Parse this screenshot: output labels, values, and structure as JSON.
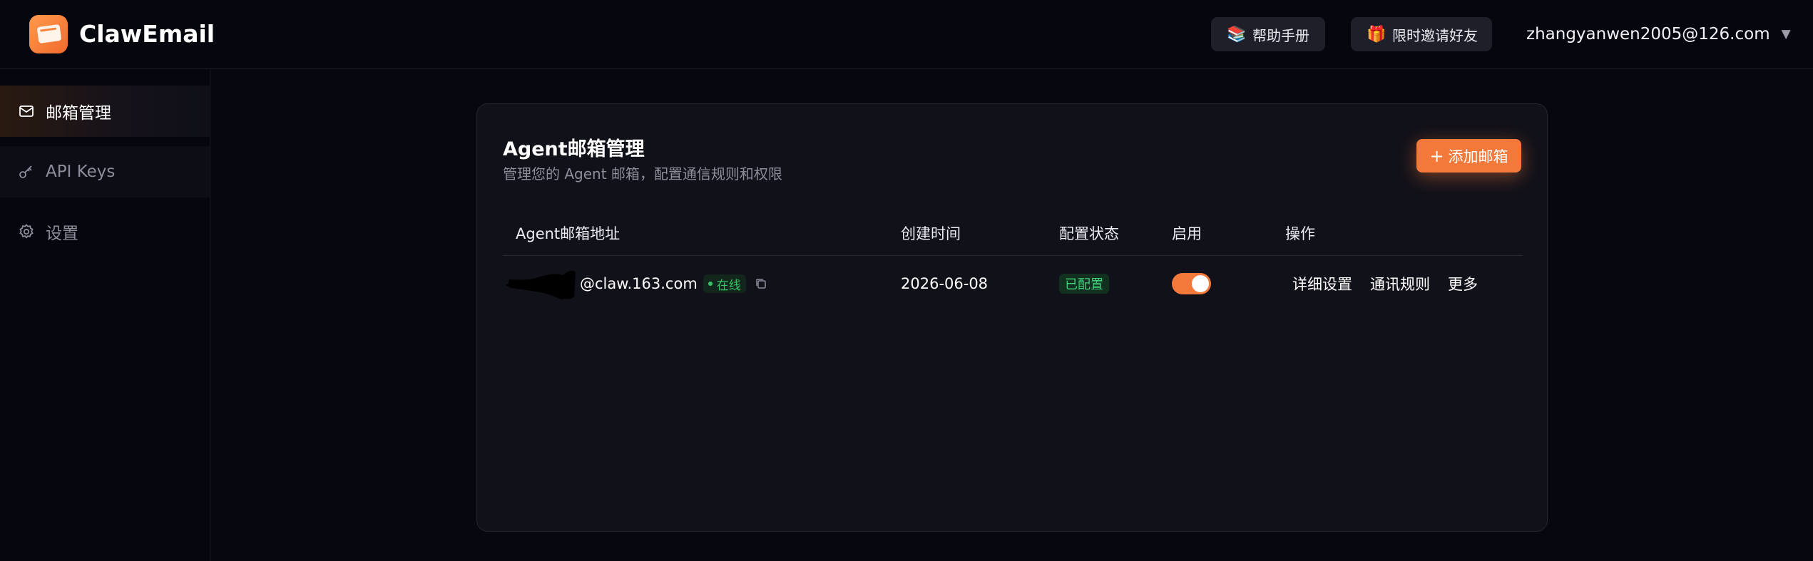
{
  "header": {
    "brand": "ClawEmail",
    "help_label": "帮助手册",
    "help_icon": "books-icon",
    "invite_label": "限时邀请好友",
    "invite_icon": "gift-icon",
    "user_email": "zhangyanwen2005@126.com"
  },
  "sidebar": {
    "items": [
      {
        "label": "邮箱管理",
        "icon": "mail-icon",
        "active": true
      },
      {
        "label": "API Keys",
        "icon": "key-icon",
        "active": false
      },
      {
        "label": "设置",
        "icon": "gear-icon",
        "active": false
      }
    ]
  },
  "main": {
    "title": "Agent邮箱管理",
    "subtitle": "管理您的 Agent 邮箱，配置通信规则和权限",
    "add_button": "添加邮箱",
    "table": {
      "columns": [
        "Agent邮箱地址",
        "创建时间",
        "配置状态",
        "启用",
        "操作"
      ],
      "rows": [
        {
          "email_domain": "@claw.163.com",
          "online_status": "在线",
          "created": "2026-06-08",
          "config_status": "已配置",
          "enabled": true,
          "actions": [
            "详细设置",
            "通讯规则",
            "更多"
          ]
        }
      ]
    }
  },
  "colors": {
    "accent": "#f3793b",
    "success": "#36c46a",
    "background": "#07070f",
    "card": "#111119"
  }
}
